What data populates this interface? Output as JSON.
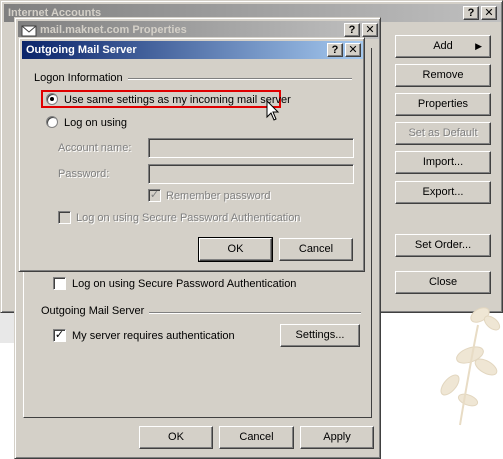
{
  "internet_accounts": {
    "title": "Internet Accounts",
    "buttons": {
      "add": "Add",
      "remove": "Remove",
      "properties": "Properties",
      "set_as_default": "Set as Default",
      "import": "Import...",
      "export": "Export...",
      "set_order": "Set Order...",
      "close": "Close"
    }
  },
  "properties": {
    "title": "mail.maknet.com Properties",
    "spa_label": "Log on using Secure Password Authentication",
    "outgoing_group": "Outgoing Mail Server",
    "requires_auth_label": "My server requires authentication",
    "settings_button": "Settings...",
    "ok": "OK",
    "cancel": "Cancel",
    "apply": "Apply"
  },
  "outgoing_dialog": {
    "title": "Outgoing Mail Server",
    "group": "Logon Information",
    "radio_same": "Use same settings as my incoming mail server",
    "radio_logon": "Log on using",
    "account_label": "Account name:",
    "password_label": "Password:",
    "remember_label": "Remember password",
    "spa_label": "Log on using Secure Password Authentication",
    "ok": "OK",
    "cancel": "Cancel"
  },
  "title_controls": {
    "help": "?",
    "close": "✕"
  }
}
